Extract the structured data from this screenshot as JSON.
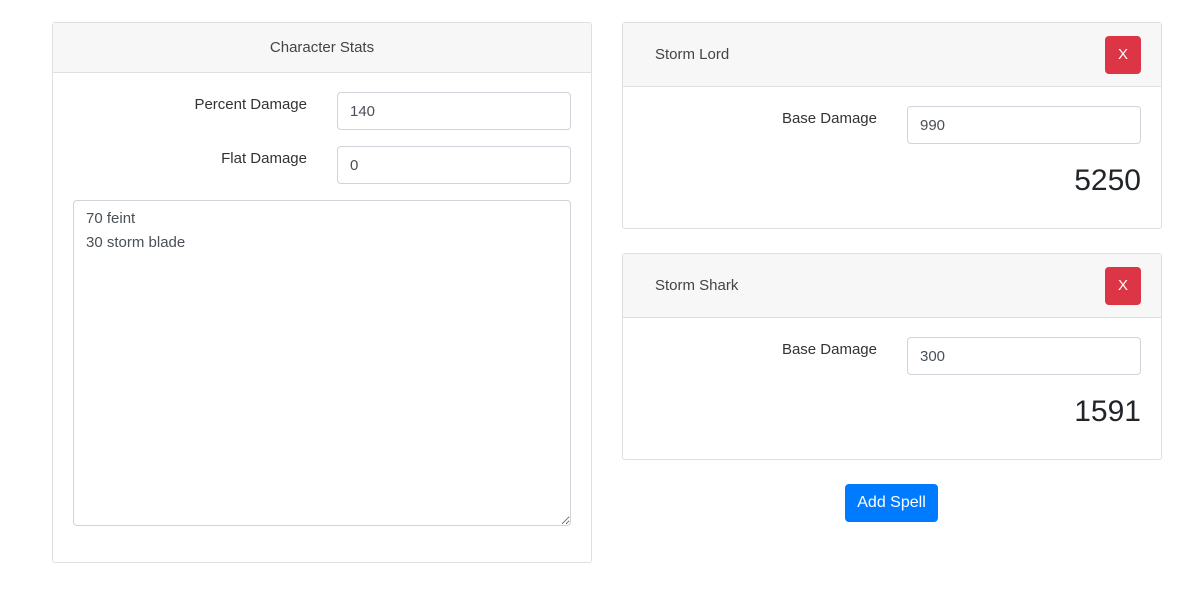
{
  "stats": {
    "title": "Character Stats",
    "percent_damage_label": "Percent Damage",
    "percent_damage_value": "140",
    "flat_damage_label": "Flat Damage",
    "flat_damage_value": "0",
    "buffs_text": "70 feint\n30 storm blade"
  },
  "spells": [
    {
      "name": "Storm Lord",
      "remove_label": "X",
      "base_damage_label": "Base Damage",
      "base_damage_value": "990",
      "result": "5250"
    },
    {
      "name": "Storm Shark",
      "remove_label": "X",
      "base_damage_label": "Base Damage",
      "base_damage_value": "300",
      "result": "1591"
    }
  ],
  "actions": {
    "add_spell_label": "Add Spell"
  },
  "colors": {
    "remove_button": "#dc3545",
    "add_button": "#007bff",
    "header_bg": "#f7f7f7"
  }
}
